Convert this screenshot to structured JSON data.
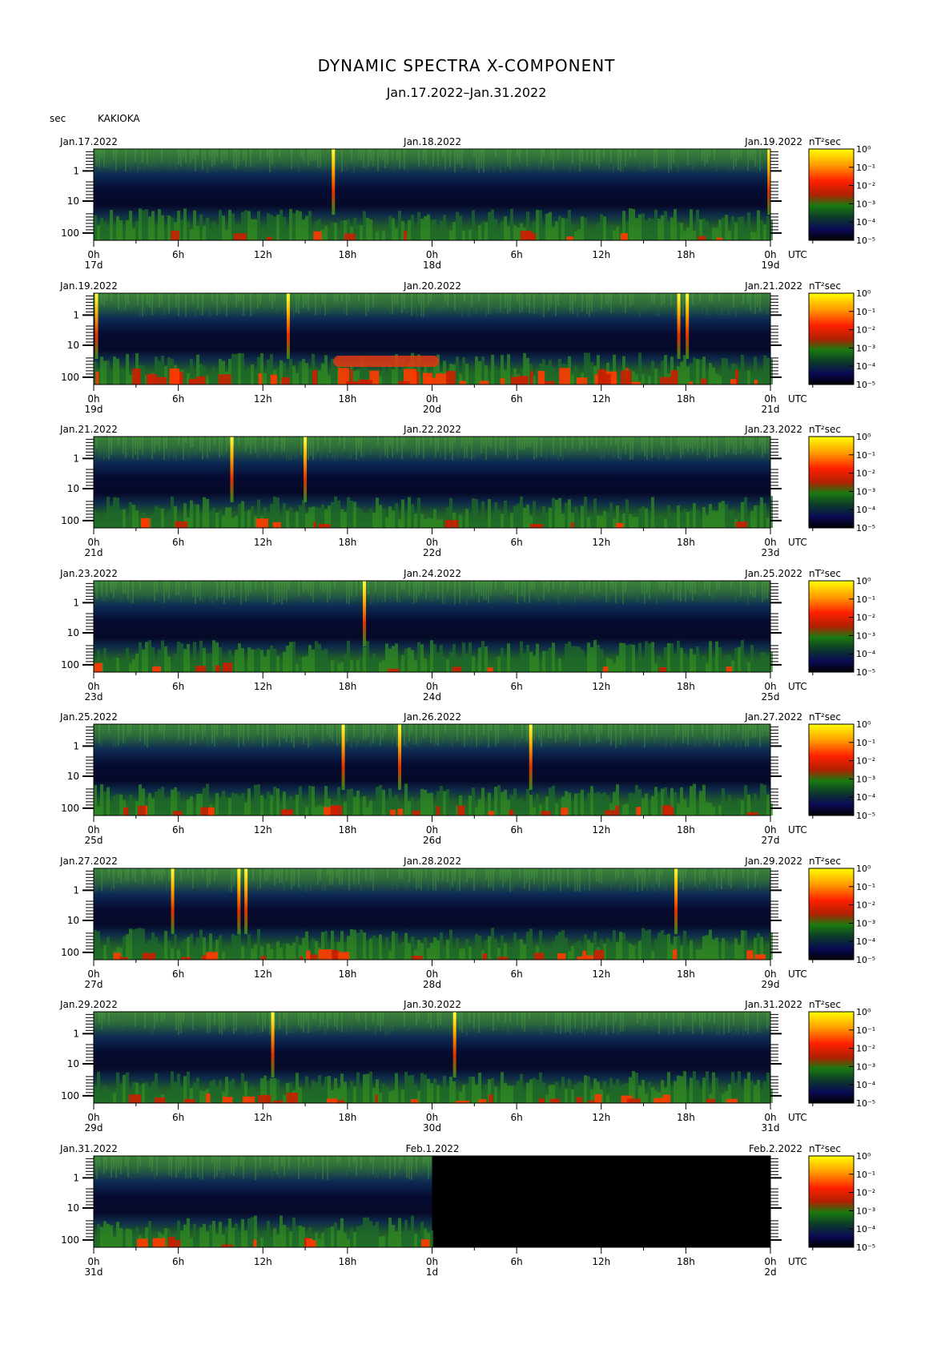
{
  "title": "DYNAMIC SPECTRA X-COMPONENT",
  "subtitle": "Jan.17.2022–Jan.31.2022",
  "station": "KAKIOKA",
  "yunit": "sec",
  "cbar_unit": "nT²sec",
  "utc_label": "UTC",
  "chart_data": {
    "type": "heatmap",
    "y_ticks": [
      "1",
      "10",
      "100"
    ],
    "y_scale": "log",
    "x_ticks": [
      "0h",
      "6h",
      "12h",
      "18h",
      "0h",
      "6h",
      "12h",
      "18h",
      "0h"
    ],
    "colorbar_ticks": [
      "10⁰",
      "10⁻¹",
      "10⁻²",
      "10⁻³",
      "10⁻⁴",
      "10⁻⁵"
    ],
    "colormap": [
      "#000000",
      "#08084a",
      "#1a5a28",
      "#2e8a1e",
      "#b02000",
      "#ff3000",
      "#ff9000",
      "#ffff00"
    ],
    "panels": [
      {
        "start": "Jan.17.2022",
        "mid": "Jan.18.2022",
        "end": "Jan.19.2022",
        "day_start": "17d",
        "day_mid": "18d",
        "day_end": "19d",
        "spikes_h": [
          17.0,
          47.9
        ],
        "red_activity": "low",
        "data_until_h": 48
      },
      {
        "start": "Jan.19.2022",
        "mid": "Jan.20.2022",
        "end": "Jan.21.2022",
        "day_start": "19d",
        "day_mid": "20d",
        "day_end": "21d",
        "spikes_h": [
          0.2,
          13.8,
          41.5,
          42.1
        ],
        "red_activity": "high",
        "data_until_h": 48
      },
      {
        "start": "Jan.21.2022",
        "mid": "Jan.22.2022",
        "end": "Jan.23.2022",
        "day_start": "21d",
        "day_mid": "22d",
        "day_end": "23d",
        "spikes_h": [
          9.8,
          15.0
        ],
        "red_activity": "low",
        "data_until_h": 48
      },
      {
        "start": "Jan.23.2022",
        "mid": "Jan.24.2022",
        "end": "Jan.25.2022",
        "day_start": "23d",
        "day_mid": "24d",
        "day_end": "25d",
        "spikes_h": [
          19.2
        ],
        "red_activity": "low",
        "data_until_h": 48
      },
      {
        "start": "Jan.25.2022",
        "mid": "Jan.26.2022",
        "end": "Jan.27.2022",
        "day_start": "25d",
        "day_mid": "26d",
        "day_end": "27d",
        "spikes_h": [
          17.7,
          21.7,
          31.0
        ],
        "red_activity": "medium",
        "data_until_h": 48
      },
      {
        "start": "Jan.27.2022",
        "mid": "Jan.28.2022",
        "end": "Jan.29.2022",
        "day_start": "27d",
        "day_mid": "28d",
        "day_end": "29d",
        "spikes_h": [
          5.6,
          10.3,
          10.8,
          41.3
        ],
        "red_activity": "medium",
        "data_until_h": 48
      },
      {
        "start": "Jan.29.2022",
        "mid": "Jan.30.2022",
        "end": "Jan.31.2022",
        "day_start": "29d",
        "day_mid": "30d",
        "day_end": "31d",
        "spikes_h": [
          12.7,
          25.6
        ],
        "red_activity": "medium",
        "data_until_h": 48
      },
      {
        "start": "Jan.31.2022",
        "mid": "Feb.1.2022",
        "end": "Feb.2.2022",
        "day_start": "31d",
        "day_mid": "1d",
        "day_end": "2d",
        "spikes_h": [],
        "red_activity": "low",
        "data_until_h": 24
      }
    ]
  }
}
